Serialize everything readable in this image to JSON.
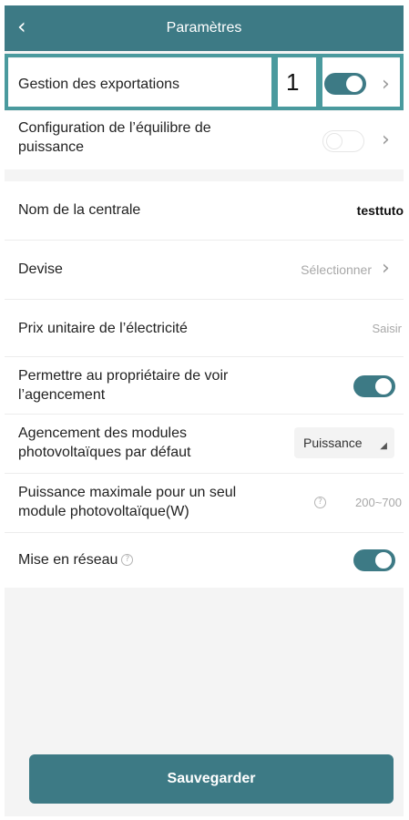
{
  "header": {
    "title": "Paramètres",
    "back_icon": "chevron-left-icon"
  },
  "rows": {
    "export_management": {
      "label": "Gestion des exportations",
      "toggle": "on",
      "callout": "1"
    },
    "power_balance": {
      "label_line1": "Configuration de l’équilibre de",
      "label_line2": "puissance",
      "toggle": "off"
    },
    "plant_name": {
      "label": "Nom de la centrale",
      "value": "testtuto"
    },
    "currency": {
      "label": "Devise",
      "value": "Sélectionner"
    },
    "unit_price": {
      "label": "Prix unitaire de l’électricité",
      "value": "Saisir"
    },
    "owner_view": {
      "label_line1": "Permettre au propriétaire de voir",
      "label_line2": "l’agencement",
      "toggle": "on"
    },
    "module_layout": {
      "label_line1": "Agencement des modules",
      "label_line2": "photovoltaïques par défaut",
      "value": "Puissance"
    },
    "max_power": {
      "label_line1": "Puissance maximale pour un seul",
      "label_line2": "module photovoltaïque(W)",
      "value": "200~700"
    },
    "network": {
      "label": "Mise en réseau",
      "toggle": "on"
    }
  },
  "save_button": {
    "label": "Sauvegarder"
  },
  "colors": {
    "accent": "#3d7a85",
    "highlight": "#4a9a9e",
    "background": "#f4f4f4"
  }
}
